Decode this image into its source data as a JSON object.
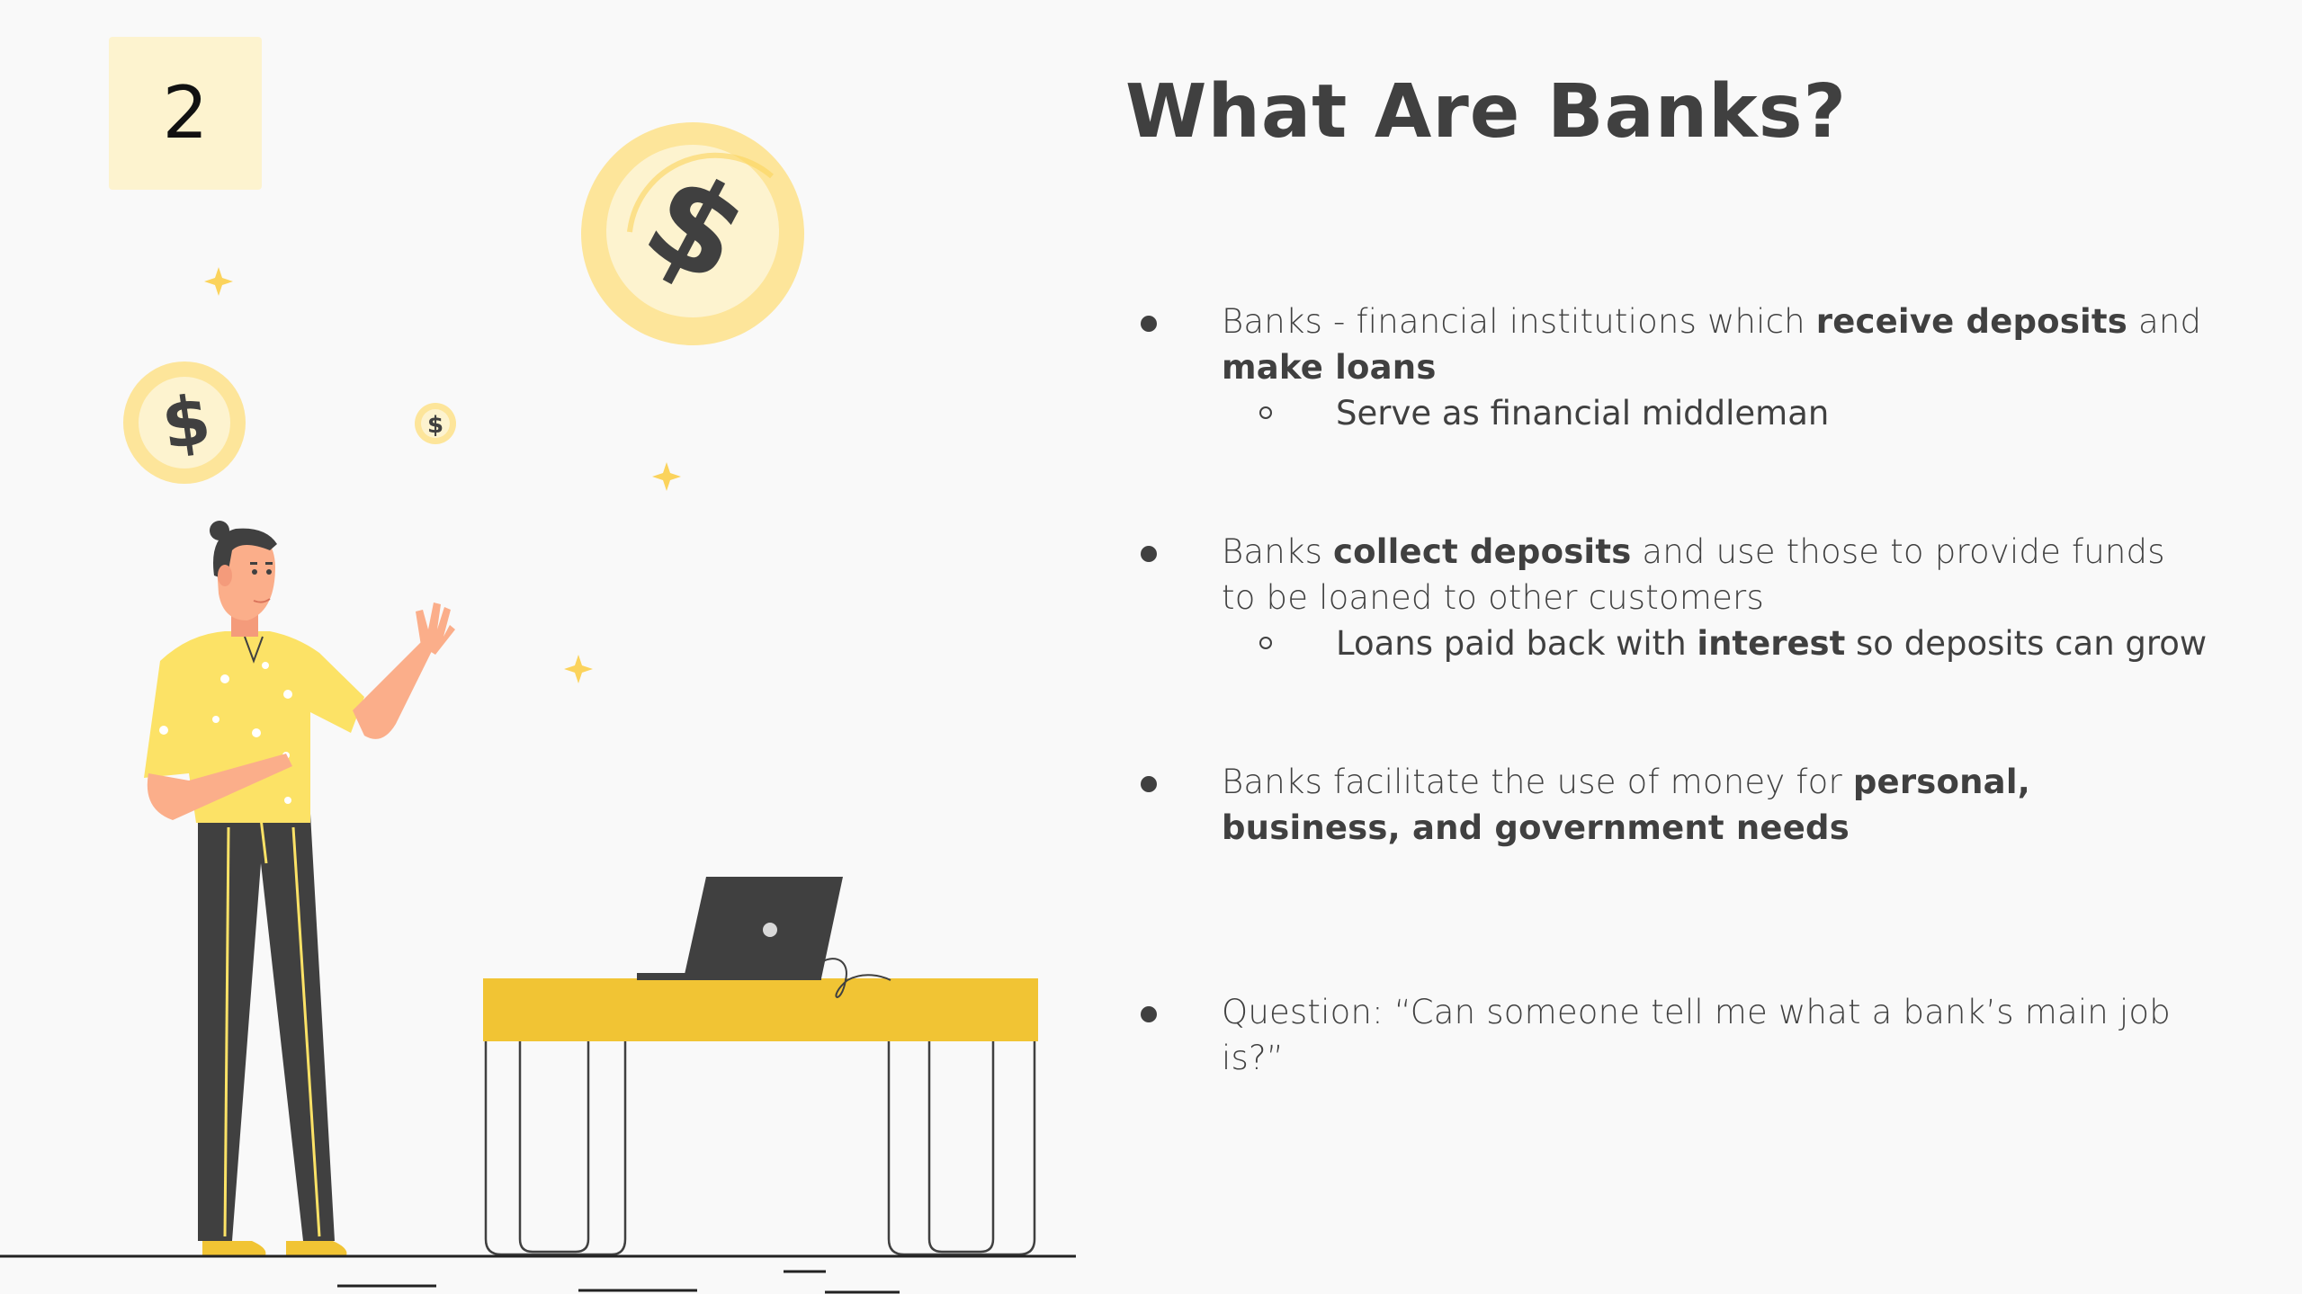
{
  "slide": {
    "number": "2",
    "title": "What Are Banks?"
  },
  "bullets": [
    {
      "segments": [
        {
          "text": "Banks - financial institutions which ",
          "bold": false
        },
        {
          "text": "receive deposits",
          "bold": true
        },
        {
          "text": " and ",
          "bold": false
        },
        {
          "text": "make loans",
          "bold": true
        }
      ],
      "sub": [
        {
          "segments": [
            {
              "text": "Serve as financial middleman",
              "bold": false
            }
          ]
        }
      ]
    },
    {
      "segments": [
        {
          "text": "Banks ",
          "bold": false
        },
        {
          "text": "collect deposits",
          "bold": true
        },
        {
          "text": " and use those to provide funds to be loaned to other customers",
          "bold": false
        }
      ],
      "sub": [
        {
          "segments": [
            {
              "text": "Loans paid back with ",
              "bold": false
            },
            {
              "text": "interest",
              "bold": true
            },
            {
              "text": " so deposits can grow",
              "bold": false
            }
          ]
        }
      ]
    },
    {
      "segments": [
        {
          "text": "Banks facilitate the use of money for ",
          "bold": false
        },
        {
          "text": "personal, business, and government needs",
          "bold": true
        }
      ],
      "sub": []
    },
    {
      "segments": [
        {
          "text": "Question: “Can someone tell me what a bank’s main job is?”",
          "bold": false
        }
      ],
      "sub": []
    }
  ],
  "illustration": {
    "coin_symbol": "$",
    "colors": {
      "accent_yellow": "#f1c434",
      "coin_outer": "#fde59a",
      "coin_inner": "#fdf3cf",
      "dark": "#404040",
      "skin": "#fbae8a",
      "shirt": "#fce266",
      "badge_bg": "#fdf3cf",
      "background": "#f9f9f9"
    },
    "icons": [
      "large-dollar-coin-icon",
      "medium-dollar-coin-icon",
      "small-dollar-coin-icon",
      "sparkle-icon",
      "laptop-icon"
    ]
  }
}
